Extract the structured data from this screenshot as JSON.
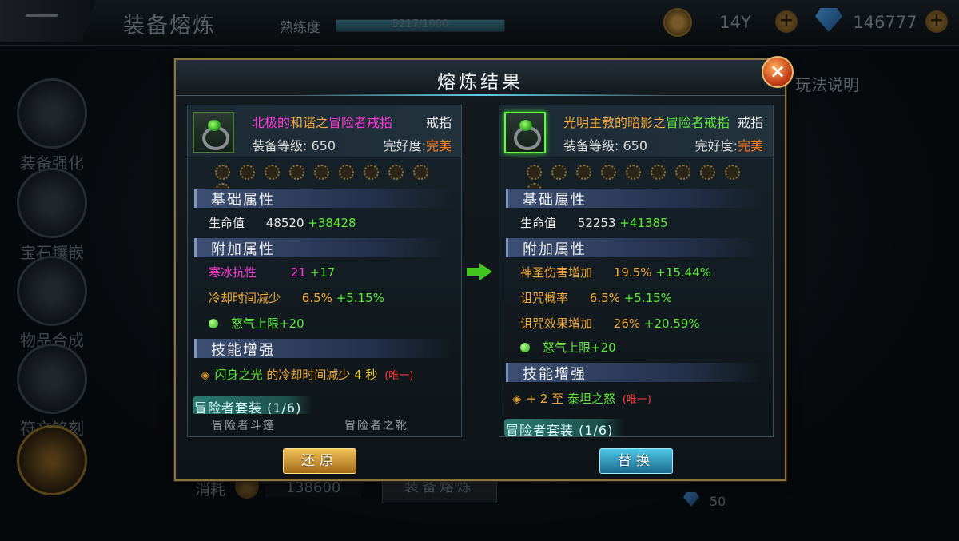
{
  "background": {
    "screen_title": "装备熔炼",
    "proficiency_label": "熟练度",
    "proficiency_text": "5217/1000",
    "gold_value": "14Y",
    "gem_value": "146777",
    "plus": "+",
    "help_text": "玩法说明",
    "nav": [
      "装备强化",
      "宝石镶嵌",
      "物品合成",
      "符文铭刻"
    ],
    "cost_label": "消耗",
    "cost_value": "138600",
    "smelt_button": "装备熔炼",
    "gem_cost": "50"
  },
  "dialog": {
    "title": "熔炼结果",
    "close": "×",
    "restore_button": "还原",
    "replace_button": "替换"
  },
  "left": {
    "name_prefix": "北极的",
    "name_mid": "和谐之",
    "name_suffix": "冒险者戒指",
    "slot": "戒指",
    "level_label": "装备等级: 650",
    "quality_label": "完好度:",
    "quality_value": "完美",
    "base_header": "基础属性",
    "hp_label": "生命值",
    "hp_value": "48520",
    "hp_bonus": "+38428",
    "extra_header": "附加属性",
    "extra": [
      {
        "label": "寒冰抗性",
        "value": "21",
        "bonus": "+17"
      },
      {
        "label": "冷却时间减少",
        "value": "6.5%",
        "bonus": "+5.15%"
      }
    ],
    "rage": "怒气上限+20",
    "skill_header": "技能增强",
    "skill_name": "闪身之光",
    "skill_text": " 的冷却时间减少 ",
    "skill_value": "4 秒",
    "skill_unique": "(唯一)",
    "set_name": "冒险者套装 (1/6)",
    "set_items": [
      "冒险者斗篷",
      "冒险者之靴"
    ]
  },
  "right": {
    "name_prefix": "光明主教的",
    "name_mid": "暗影之",
    "name_suffix": "冒险者戒指",
    "slot": "戒指",
    "level_label": "装备等级: 650",
    "quality_label": "完好度:",
    "quality_value": "完美",
    "base_header": "基础属性",
    "hp_label": "生命值",
    "hp_value": "52253",
    "hp_bonus": "+41385",
    "extra_header": "附加属性",
    "extra": [
      {
        "label": "神圣伤害增加",
        "value": "19.5%",
        "bonus": "+15.44%"
      },
      {
        "label": "诅咒概率",
        "value": "6.5%",
        "bonus": "+5.15%"
      },
      {
        "label": "诅咒效果增加",
        "value": "26%",
        "bonus": "+20.59%"
      }
    ],
    "rage": "怒气上限+20",
    "skill_header": "技能增强",
    "skill_prefix": "+ 2 至 ",
    "skill_name": "泰坦之怒",
    "skill_unique": "(唯一)",
    "set_name": "冒险者套装 (1/6)"
  },
  "colors": {
    "gold_border": "#8a7540",
    "accent_green": "#5fe83a",
    "quality_orange": "#ff7a1a"
  }
}
